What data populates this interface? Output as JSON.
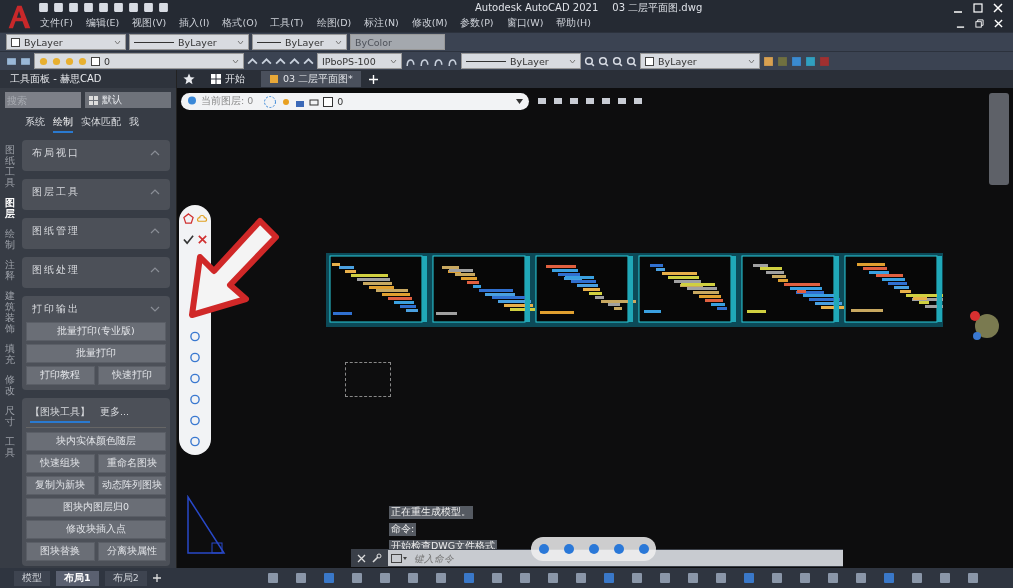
{
  "window": {
    "title": "Autodesk AutoCAD 2021",
    "file": "03 二层平面图.dwg"
  },
  "menu": [
    "文件(F)",
    "编辑(E)",
    "视图(V)",
    "插入(I)",
    "格式(O)",
    "工具(T)",
    "绘图(D)",
    "标注(N)",
    "修改(M)",
    "参数(P)",
    "窗口(W)",
    "帮助(H)"
  ],
  "properties_toolbar": {
    "object_color": "ByLayer",
    "linetype": "ByLayer",
    "lineweight": "ByLayer",
    "plot_style": {
      "value": "ByColor",
      "disabled": true
    }
  },
  "layers_toolbar": {
    "layer": "0",
    "plot_style_table": "IPboPS-100",
    "linetype": "ByLayer",
    "layer_color": "ByLayer"
  },
  "tool_palette": {
    "title": "工具面板 - 赫思CAD",
    "search": {
      "placeholder": "搜索"
    },
    "preset": "默认",
    "tabs": [
      {
        "label": "系统",
        "selected": false
      },
      {
        "label": "绘制",
        "selected": true
      },
      {
        "label": "实体匹配",
        "selected": false
      },
      {
        "label": "我",
        "selected": false
      }
    ],
    "side_tabs": [
      {
        "label": "图纸工具",
        "selected": false
      },
      {
        "label": "图层",
        "selected": true
      },
      {
        "label": "绘制",
        "selected": false
      },
      {
        "label": "注释",
        "selected": false
      },
      {
        "label": "建筑装饰",
        "selected": false
      },
      {
        "label": "填充",
        "selected": false
      },
      {
        "label": "修改",
        "selected": false
      },
      {
        "label": "尺寸",
        "selected": false
      },
      {
        "label": "工具",
        "selected": false
      }
    ],
    "sections": [
      {
        "title": "布局视口",
        "expanded": false
      },
      {
        "title": "图层工具",
        "expanded": false
      },
      {
        "title": "图纸管理",
        "expanded": false
      },
      {
        "title": "图纸处理",
        "expanded": false
      },
      {
        "title": "打印输出",
        "expanded": true,
        "buttons": [
          {
            "label": "批量打印(专业版)",
            "kind": "wide"
          },
          {
            "label": "批量打印",
            "kind": "wide"
          },
          {
            "label": "打印教程",
            "kind": "half"
          },
          {
            "label": "快速打印",
            "kind": "half"
          }
        ]
      }
    ],
    "block_tabs": [
      {
        "label": "【图块工具】",
        "selected": true
      },
      {
        "label": "更多...",
        "selected": false
      }
    ],
    "block_buttons": [
      {
        "label": "块内实体颜色随层",
        "kind": "wide"
      },
      {
        "label": "快速组块",
        "kind": "half"
      },
      {
        "label": "重命名图块",
        "kind": "half"
      },
      {
        "label": "复制为新块",
        "kind": "half"
      },
      {
        "label": "动态阵列图块",
        "kind": "half"
      },
      {
        "label": "图块内图层归0",
        "kind": "wide"
      },
      {
        "label": "修改块插入点",
        "kind": "wide"
      },
      {
        "label": "图块替换",
        "kind": "half"
      },
      {
        "label": "分离块属性",
        "kind": "half"
      }
    ]
  },
  "doc_tabs": [
    {
      "label": "开始",
      "kind": "start",
      "selected": false
    },
    {
      "label": "03 二层平面图*",
      "kind": "file",
      "selected": true
    }
  ],
  "layer_bar": {
    "label": "当前图层: 0",
    "layer": "0"
  },
  "command_history": [
    "正在重生成模型。",
    "命令:",
    "开始检查DWG文件格式"
  ],
  "command_line": {
    "placeholder": "键入命令"
  },
  "layout_tabs": [
    {
      "label": "模型",
      "selected": false
    },
    {
      "label": "布局1",
      "selected": true
    },
    {
      "label": "布局2",
      "selected": false
    }
  ]
}
